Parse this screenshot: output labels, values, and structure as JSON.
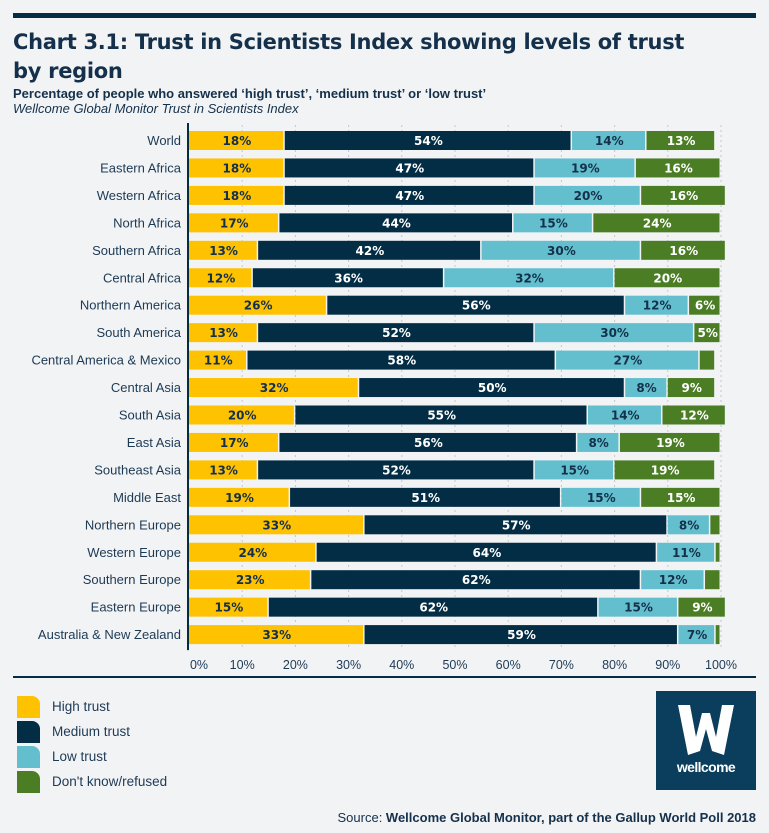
{
  "header": {
    "title": "Chart 3.1: Trust in Scientists Index showing levels of trust by region",
    "subtitle": "Percentage of people who answered ‘high trust’, ‘medium trust’ or ‘low trust’",
    "index_name": "Wellcome Global Monitor Trust in Scientists Index"
  },
  "colors": {
    "high": "#fec200",
    "medium": "#032d45",
    "low": "#63bfce",
    "dk": "#4b7d24",
    "dark_text": "#14304a",
    "light_text": "#ffffff"
  },
  "chart_data": {
    "type": "bar",
    "orientation": "horizontal",
    "stacked": true,
    "title": "Chart 3.1: Trust in Scientists Index showing levels of trust by region",
    "subtitle": "Percentage of people who answered ‘high trust’, ‘medium trust’ or ‘low trust’",
    "xlabel": "",
    "ylabel": "",
    "xlim": [
      0,
      100
    ],
    "x_ticks": [
      "0%",
      "10%",
      "20%",
      "30%",
      "40%",
      "50%",
      "60%",
      "70%",
      "80%",
      "90%",
      "100%"
    ],
    "grid": "vertical dotted",
    "legend_position": "bottom-left",
    "categories": [
      "World",
      "Eastern Africa",
      "Western Africa",
      "North Africa",
      "Southern Africa",
      "Central Africa",
      "Northern America",
      "South America",
      "Central America & Mexico",
      "Central Asia",
      "South Asia",
      "East Asia",
      "Southeast Asia",
      "Middle East",
      "Northern Europe",
      "Western Europe",
      "Southern Europe",
      "Eastern Europe",
      "Australia & New Zealand"
    ],
    "series": [
      {
        "name": "High trust",
        "key": "high",
        "values": [
          18,
          18,
          18,
          17,
          13,
          12,
          26,
          13,
          11,
          32,
          20,
          17,
          13,
          19,
          33,
          24,
          23,
          15,
          33
        ],
        "labels": [
          "18%",
          "18%",
          "18%",
          "17%",
          "13%",
          "12%",
          "26%",
          "13%",
          "11%",
          "32%",
          "20%",
          "17%",
          "13%",
          "19%",
          "33%",
          "24%",
          "23%",
          "15%",
          "33%"
        ]
      },
      {
        "name": "Medium trust",
        "key": "medium",
        "values": [
          54,
          47,
          47,
          44,
          42,
          36,
          56,
          52,
          58,
          50,
          55,
          56,
          52,
          51,
          57,
          64,
          62,
          62,
          59
        ],
        "labels": [
          "54%",
          "47%",
          "47%",
          "44%",
          "42%",
          "36%",
          "56%",
          "52%",
          "58%",
          "50%",
          "55%",
          "56%",
          "52%",
          "51%",
          "57%",
          "64%",
          "62%",
          "62%",
          "59%"
        ]
      },
      {
        "name": "Low trust",
        "key": "low",
        "values": [
          14,
          19,
          20,
          15,
          30,
          32,
          12,
          30,
          27,
          8,
          14,
          8,
          15,
          15,
          8,
          11,
          12,
          15,
          7
        ],
        "labels": [
          "14%",
          "19%",
          "20%",
          "15%",
          "30%",
          "32%",
          "12%",
          "30%",
          "27%",
          "8%",
          "14%",
          "8%",
          "15%",
          "15%",
          "8%",
          "11%",
          "12%",
          "15%",
          "7%"
        ]
      },
      {
        "name": "Don't know/refused",
        "key": "dk",
        "values": [
          13,
          16,
          16,
          24,
          16,
          20,
          6,
          5,
          3,
          9,
          12,
          19,
          19,
          15,
          2,
          1,
          3,
          9,
          1
        ],
        "labels": [
          "13%",
          "16%",
          "16%",
          "24%",
          "16%",
          "20%",
          "6%",
          "5%",
          "",
          "9%",
          "12%",
          "19%",
          "19%",
          "15%",
          "",
          "",
          "",
          "9%",
          ""
        ]
      }
    ]
  },
  "legend": [
    {
      "label": "High trust",
      "key": "high"
    },
    {
      "label": "Medium trust",
      "key": "medium"
    },
    {
      "label": "Low trust",
      "key": "low"
    },
    {
      "label": "Don't know/refused",
      "key": "dk"
    }
  ],
  "logo": {
    "letter": "W",
    "text": "wellcome"
  },
  "footer": {
    "prefix": "Source: ",
    "source": "Wellcome Global Monitor, part of the Gallup World Poll 2018"
  }
}
